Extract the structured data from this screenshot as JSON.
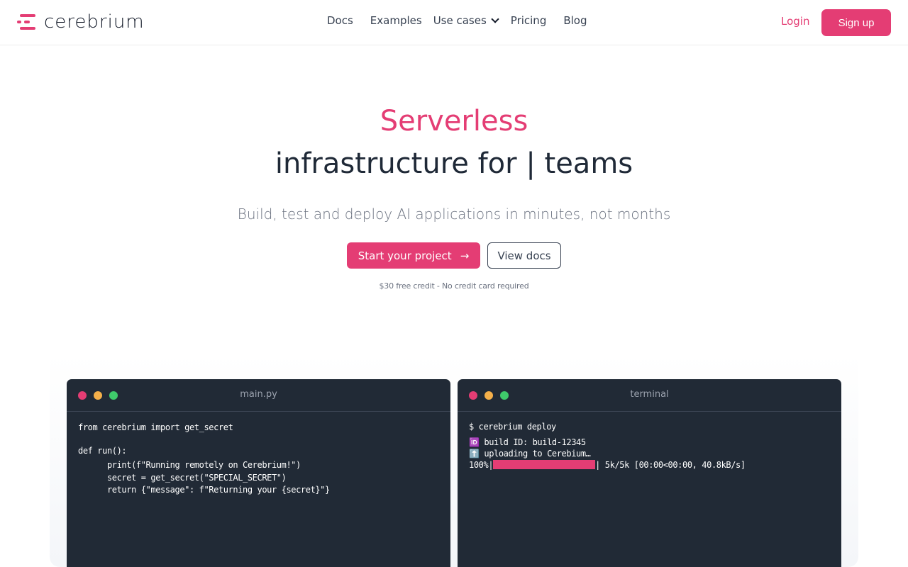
{
  "nav": {
    "logo_text": "cerebrium",
    "links": {
      "docs": "Docs",
      "examples": "Examples",
      "use_cases": "Use cases",
      "pricing": "Pricing",
      "blog": "Blog"
    },
    "login": "Login",
    "signup": "Sign up"
  },
  "hero": {
    "accent": "Serverless",
    "title": "infrastructure for | teams",
    "subtitle": "Build, test and deploy AI applications in minutes, not months",
    "primary_cta": "Start your project",
    "secondary_cta": "View docs",
    "credit_note": "$30 free credit - No credit card required"
  },
  "editor": {
    "title": "main.py",
    "lines": [
      "from cerebrium import get_secret",
      "def run():",
      "      print(f\"Running remotely on Cerebrium!\")",
      "      secret = get_secret(\"SPECIAL_SECRET\")",
      "      return {\"message\": f\"Returning your {secret}\"}"
    ]
  },
  "terminal": {
    "title": "terminal",
    "command": "$ cerebrium deploy",
    "build_line": "🆔 build ID: build-12345",
    "upload_line": "⬆️ uploading to Cerebium…",
    "progress_percent_label": "100%",
    "progress_value": 1.0,
    "progress_stats": "5k/5k [00:00<00:00, 40.8kB/s]"
  },
  "colors": {
    "brand": "#e43d74",
    "window_bg": "#212a36",
    "dot_yellow": "#f5b04a",
    "dot_green": "#3fca6b"
  },
  "icons": {
    "logo": "cerebrium-logo-icon",
    "chevron": "chevron-down-icon",
    "arrow": "arrow-right-icon"
  }
}
